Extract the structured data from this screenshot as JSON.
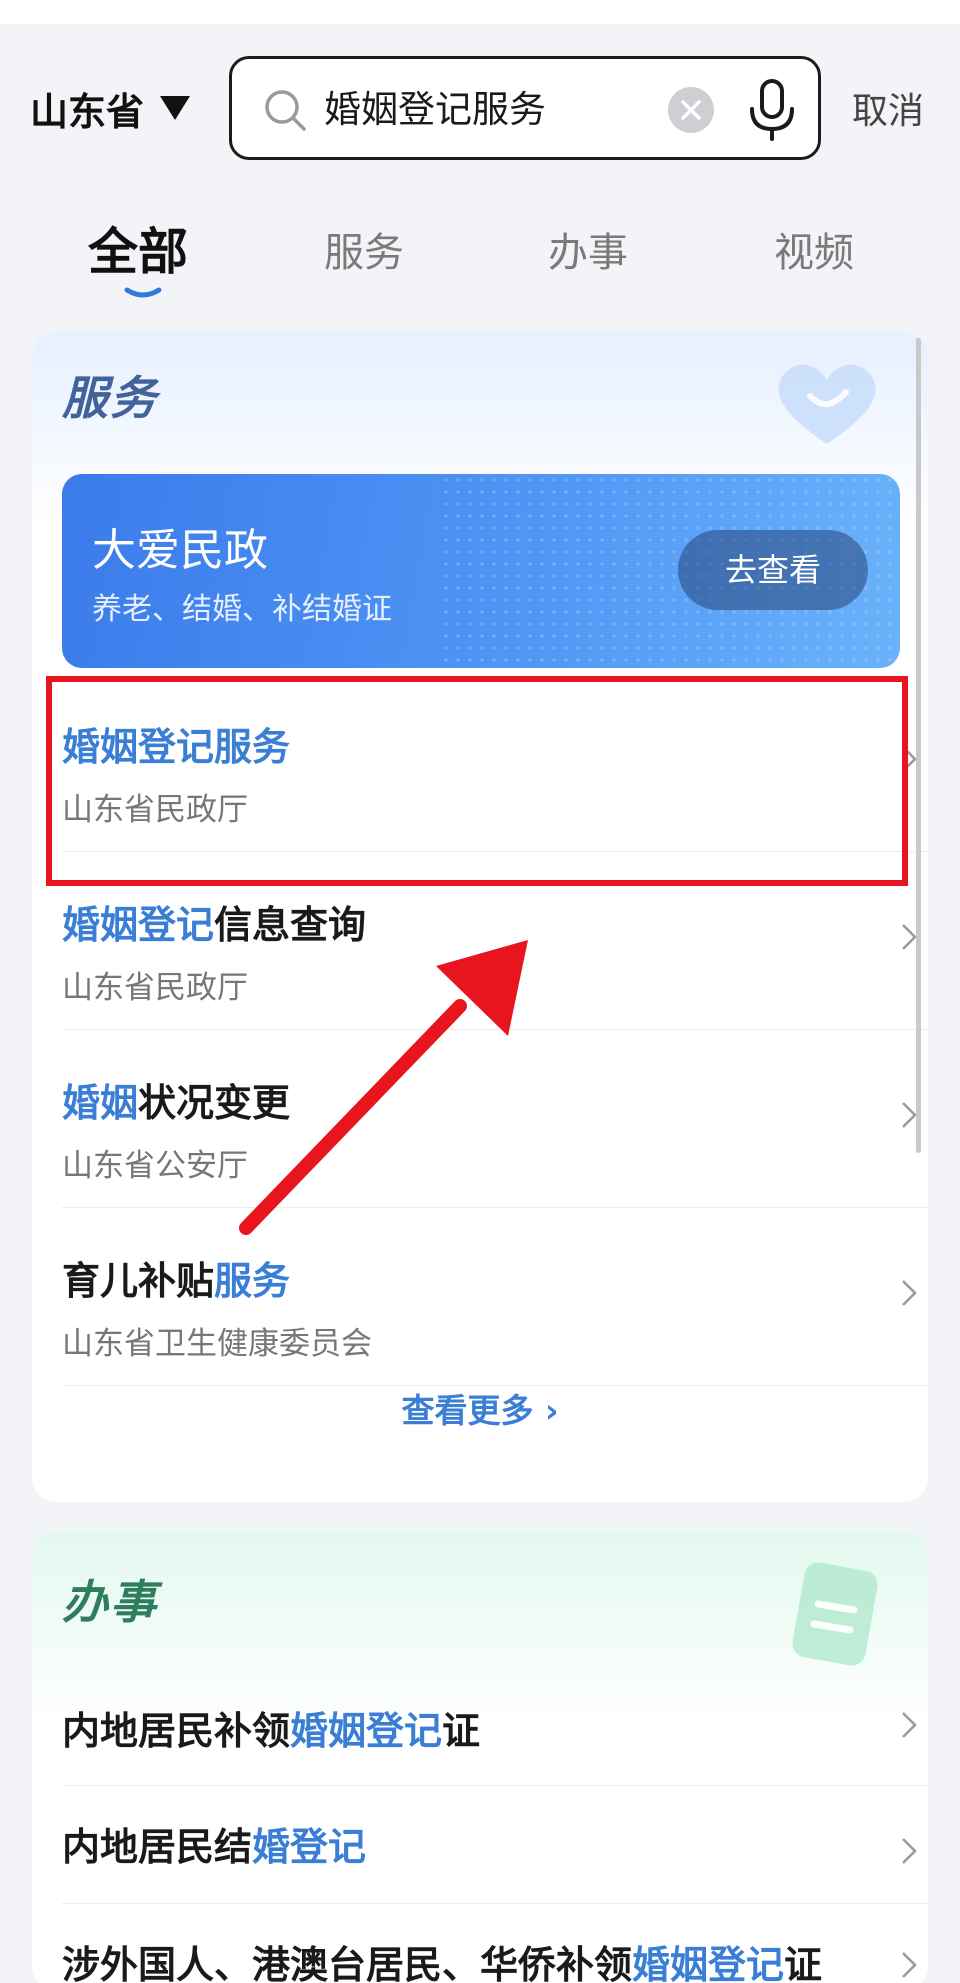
{
  "header": {
    "region": "山东省",
    "search_value": "婚姻登记服务",
    "cancel": "取消"
  },
  "tabs": [
    {
      "label": "全部",
      "active": true
    },
    {
      "label": "服务",
      "active": false
    },
    {
      "label": "办事",
      "active": false
    },
    {
      "label": "视频",
      "active": false
    }
  ],
  "services": {
    "title": "服务",
    "banner": {
      "title": "大爱民政",
      "subtitle": "养老、结婚、补结婚证",
      "button": "去查看"
    },
    "items": [
      {
        "hl": "婚姻登记服务",
        "rest": "",
        "org": "山东省民政厅"
      },
      {
        "hl": "婚姻登记",
        "rest": "信息查询",
        "org": "山东省民政厅"
      },
      {
        "hl": "婚姻",
        "rest": "状况变更",
        "org": "山东省公安厅"
      },
      {
        "pre": "育儿补贴",
        "hl": "服务",
        "org": "山东省卫生健康委员会"
      }
    ],
    "more": "查看更多"
  },
  "affairs": {
    "title": "办事",
    "items": [
      {
        "pre": "内地居民补领",
        "hl": "婚姻登记",
        "post": "证"
      },
      {
        "pre": "内地居民结",
        "hl": "婚登记",
        "post": ""
      },
      {
        "pre": "涉外国人、港澳台居民、华侨补领",
        "hl": "婚姻登记",
        "post": "证"
      }
    ]
  },
  "colors": {
    "accent": "#3a7fd5",
    "annotation": "#e8141e",
    "banner": "#4f96f5"
  }
}
